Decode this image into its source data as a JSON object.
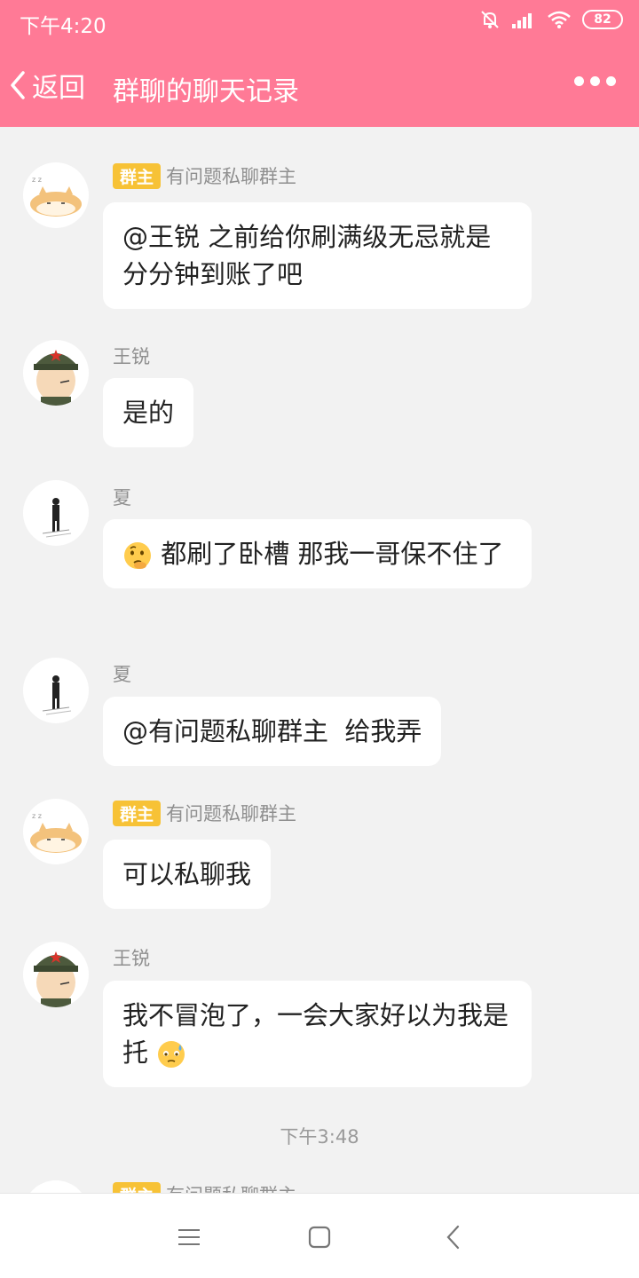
{
  "status_bar": {
    "time": "下午4:20",
    "battery": "82",
    "icons": [
      "mute-bell-icon",
      "signal-icon",
      "wifi-icon",
      "battery-icon"
    ]
  },
  "header": {
    "back_label": "返回",
    "title": "群聊的聊天记录",
    "more_icon": "more-dots-icon",
    "background": "#ff7a96"
  },
  "messages": [
    {
      "badge": "群主",
      "name": "有问题私聊群主",
      "text": "@王锐 之前给你刷满级无忌就是分分钟到账了吧",
      "avatar": "hamster-avatar"
    },
    {
      "name": "王锐",
      "text": "是的",
      "avatar": "soldier-avatar"
    },
    {
      "name": "夏",
      "text": "都刷了卧槽 那我一哥保不住了",
      "emoji": "thinking-face-emoji",
      "avatar": "silhouette-avatar"
    },
    {
      "name": "夏",
      "text": "@有问题私聊群主  给我弄",
      "avatar": "silhouette-avatar"
    },
    {
      "badge": "群主",
      "name": "有问题私聊群主",
      "text": "可以私聊我",
      "avatar": "hamster-avatar"
    },
    {
      "name": "王锐",
      "text": "我不冒泡了，一会大家好以为我是托",
      "emoji": "sweat-face-emoji",
      "avatar": "soldier-avatar"
    }
  ],
  "timestamp": "下午3:48",
  "partial_message": {
    "badge": "群主",
    "name": "有问题私聊群主"
  },
  "nav_bar": {
    "menu_icon": "menu-icon",
    "home_icon": "home-icon",
    "back_icon": "back-icon"
  }
}
